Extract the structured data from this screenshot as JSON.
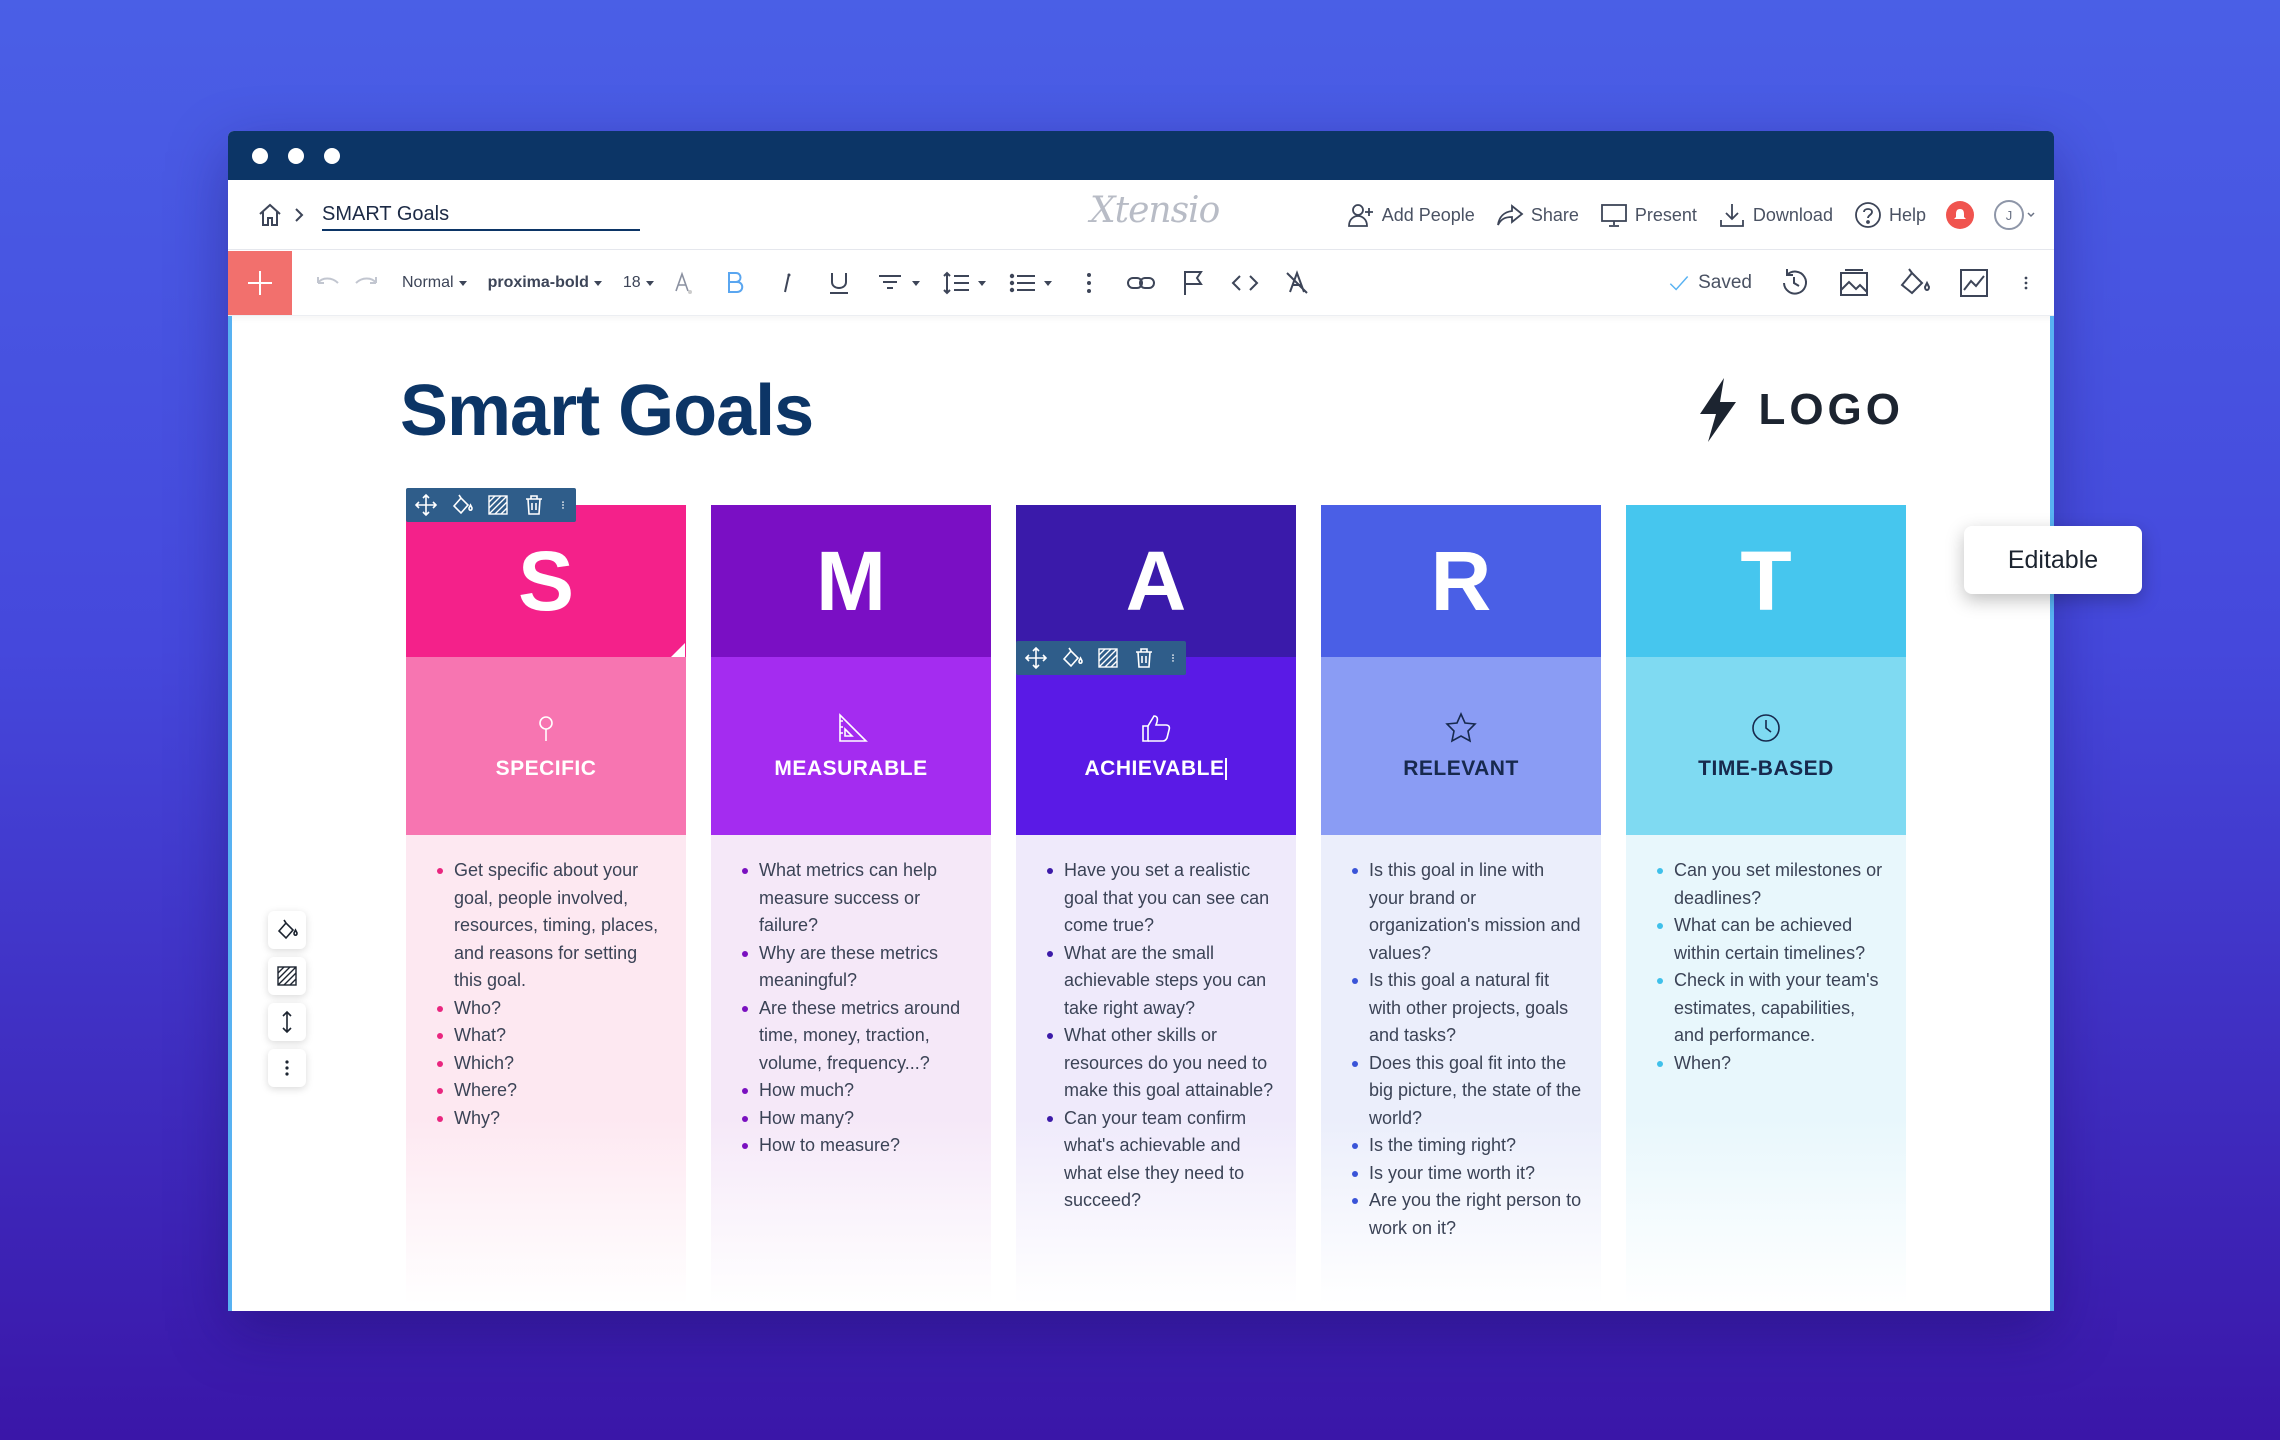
{
  "window": {
    "dots": 3
  },
  "topbar": {
    "doc_title": "SMART Goals",
    "brand": "Xtensio",
    "actions": [
      {
        "label": "Add People",
        "icon": "add-people-icon"
      },
      {
        "label": "Share",
        "icon": "share-icon"
      },
      {
        "label": "Present",
        "icon": "present-icon"
      },
      {
        "label": "Download",
        "icon": "download-icon"
      },
      {
        "label": "Help",
        "icon": "help-icon"
      }
    ],
    "avatar_initial": "J"
  },
  "toolbar": {
    "style": "Normal",
    "font": "proxima-bold",
    "size": "18",
    "saved": "Saved"
  },
  "doc": {
    "heading": "Smart Goals",
    "logo_text": "LOGO"
  },
  "columns": [
    {
      "letter": "S",
      "title": "SPECIFIC",
      "icon": "pin-icon",
      "colors": {
        "letter_bg": "#f4218a",
        "head_bg": "#f775b1",
        "body_bg": "#fde8f1",
        "bullet": "#e9257f",
        "title": "#ffffff"
      },
      "items": [
        "Get specific about your goal, people involved, resources, timing, places, and reasons for setting this goal.",
        "Who?",
        "What?",
        "Which?",
        "Where?",
        "Why?"
      ]
    },
    {
      "letter": "M",
      "title": "MEASURABLE",
      "icon": "ruler-triangle-icon",
      "colors": {
        "letter_bg": "#7a0fc4",
        "head_bg": "#a42cf0",
        "body_bg": "#f5e8f8",
        "bullet": "#7a10c0",
        "title": "#ffffff"
      },
      "items": [
        "What metrics can help measure success or failure?",
        "Why are these metrics meaningful?",
        "Are these metrics around time, money, traction, volume, frequency...?",
        "How much?",
        "How many?",
        "How to measure?"
      ]
    },
    {
      "letter": "A",
      "title": "ACHIEVABLE",
      "icon": "thumbs-up-icon",
      "colors": {
        "letter_bg": "#3a1aaa",
        "head_bg": "#5a1ae6",
        "body_bg": "#efeafb",
        "bullet": "#3c1aa8",
        "title": "#ffffff"
      },
      "items": [
        "Have you set a realistic goal that you can see can come true?",
        "What are the small achievable steps you can take right away?",
        "What other skills or resources do you need to make this goal attainable?",
        "Can your team confirm what's achievable and what else they need to succeed?"
      ]
    },
    {
      "letter": "R",
      "title": "RELEVANT",
      "icon": "star-icon",
      "colors": {
        "letter_bg": "#4a5fe6",
        "head_bg": "#8a9cf4",
        "body_bg": "#ebeefb",
        "bullet": "#3a54d8",
        "title": "#17294d"
      },
      "items": [
        "Is this goal in line with your brand or organization's mission and values?",
        "Is this goal a natural fit with other projects, goals and tasks?",
        "Does this goal fit into the big picture, the state of the world?",
        "Is the timing right?",
        "Is your time worth it?",
        "Are you the right person to work on it?"
      ]
    },
    {
      "letter": "T",
      "title": "TIME-BASED",
      "icon": "clock-icon",
      "colors": {
        "letter_bg": "#46c6ee",
        "head_bg": "#7fdaf2",
        "body_bg": "#e8f7fc",
        "bullet": "#3fc0ea",
        "title": "#17294d"
      },
      "items": [
        "Can you set milestones or deadlines?",
        "What can be achieved within certain timelines?",
        "Check in with your team's estimates, capabilities, and performance.",
        "When?"
      ]
    }
  ],
  "tooltip": {
    "label": "Editable"
  }
}
